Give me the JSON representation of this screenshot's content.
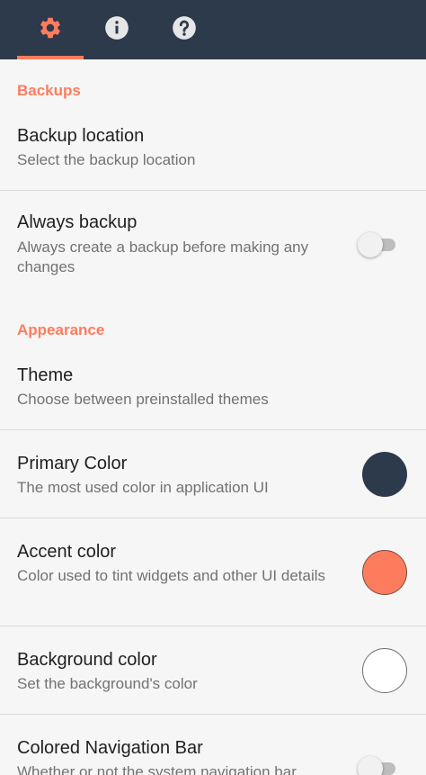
{
  "toolbar": {
    "background": "#2c3a4b",
    "tabs": [
      {
        "icon": "gear-icon",
        "active": true
      },
      {
        "icon": "info-icon",
        "active": false
      },
      {
        "icon": "help-icon",
        "active": false
      }
    ]
  },
  "colors": {
    "accent": "#fe7c5e",
    "primary": "#2c3a4b"
  },
  "sections": {
    "backups": "Backups",
    "appearance": "Appearance"
  },
  "prefs": {
    "backup_location": {
      "title": "Backup location",
      "summary": "Select the backup location"
    },
    "always_backup": {
      "title": "Always backup",
      "summary": "Always create a backup before making any changes",
      "checked": false
    },
    "theme": {
      "title": "Theme",
      "summary": "Choose between preinstalled themes"
    },
    "primary_color": {
      "title": "Primary Color",
      "summary": "The most used color in application UI",
      "color": "#2c3a4b"
    },
    "accent_color": {
      "title": "Accent color",
      "summary": "Color used to tint widgets and other UI details",
      "color": "#fe7c5e"
    },
    "background_color": {
      "title": "Background color",
      "summary": "Set the background's color",
      "color": "#ffffff"
    },
    "colored_nav_bar": {
      "title": "Colored Navigation Bar",
      "summary": "Whether or not the system navigation bar",
      "checked": false
    }
  }
}
